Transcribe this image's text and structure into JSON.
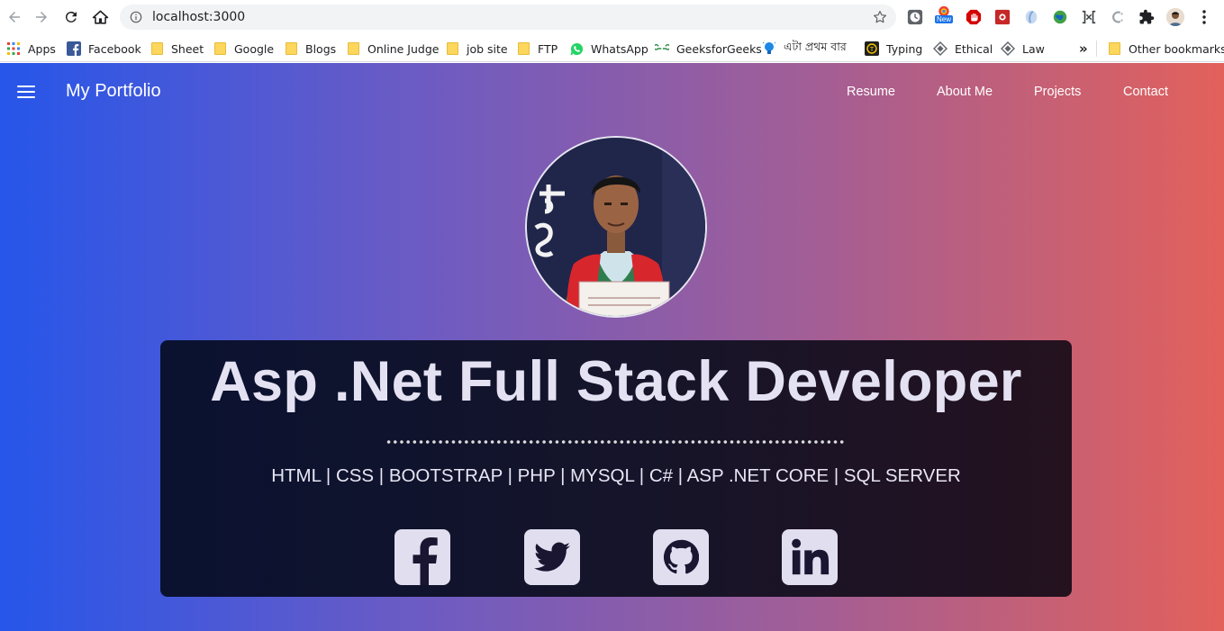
{
  "browser": {
    "url": "localhost:3000",
    "extension_new_badge": "New",
    "bookmarks": [
      {
        "label": "Apps",
        "icon": "apps-grid-icon"
      },
      {
        "label": "Facebook",
        "icon": "facebook-icon"
      },
      {
        "label": "Sheet",
        "icon": "folder-icon"
      },
      {
        "label": "Google",
        "icon": "folder-icon"
      },
      {
        "label": "Blogs",
        "icon": "folder-icon"
      },
      {
        "label": "Online Judge",
        "icon": "folder-icon"
      },
      {
        "label": "job site",
        "icon": "folder-icon"
      },
      {
        "label": "FTP",
        "icon": "folder-icon"
      },
      {
        "label": "WhatsApp",
        "icon": "whatsapp-icon"
      },
      {
        "label": "GeeksforGeeks",
        "icon": "geeksforgeeks-icon"
      },
      {
        "label": "এটা প্রথম বার",
        "icon": "bulb-icon"
      },
      {
        "label": "Typing",
        "icon": "typing-icon"
      },
      {
        "label": "Ethical",
        "icon": "diamond-icon"
      },
      {
        "label": "Law",
        "icon": "diamond-icon"
      }
    ],
    "overflow_label": "»",
    "other_bookmarks": "Other bookmarks"
  },
  "portfolio": {
    "brand": "My Portfolio",
    "nav": [
      "Resume",
      "About Me",
      "Projects",
      "Contact"
    ],
    "title": "Asp .Net Full Stack Developer",
    "skills": "HTML | CSS | BOOTSTRAP | PHP | MYSQL | C# | ASP .NET CORE | SQL SERVER",
    "social": [
      "facebook-icon",
      "twitter-icon",
      "github-icon",
      "linkedin-icon"
    ]
  },
  "colors": {
    "gradient": [
      "#2656ea",
      "#6a5bc5",
      "#a25e96",
      "#e2615b"
    ],
    "hero_bg": "#0a1230",
    "hero_text": "#e4e2f2"
  }
}
